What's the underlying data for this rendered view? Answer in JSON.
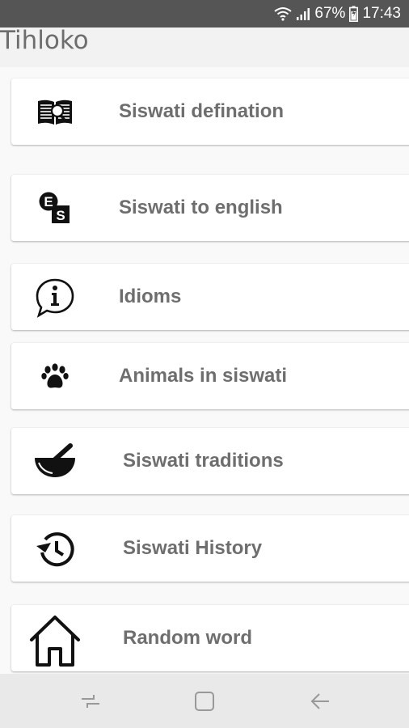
{
  "status_bar": {
    "battery_percent": "67%",
    "time": "17:43"
  },
  "app": {
    "title": "Tihloko"
  },
  "menu": [
    {
      "label": "Siswati defination",
      "icon": "dictionary-book-icon"
    },
    {
      "label": "Siswati to english",
      "icon": "translate-icon"
    },
    {
      "label": "Idioms",
      "icon": "info-speech-bubble-icon"
    },
    {
      "label": "Animals in siswati",
      "icon": "paw-icon"
    },
    {
      "label": "Siswati traditions",
      "icon": "mortar-pestle-icon"
    },
    {
      "label": "Siswati History",
      "icon": "history-icon"
    },
    {
      "label": "Random word",
      "icon": "home-icon"
    }
  ],
  "translate_icon_letters": {
    "top": "E",
    "bottom": "S"
  },
  "nav_bar": {
    "icons": [
      "recent-apps-icon",
      "home-button-icon",
      "back-icon"
    ]
  },
  "colors": {
    "status_bar": "#555555",
    "label_text": "#6e6e6e",
    "title_text": "#6d6d6d"
  }
}
